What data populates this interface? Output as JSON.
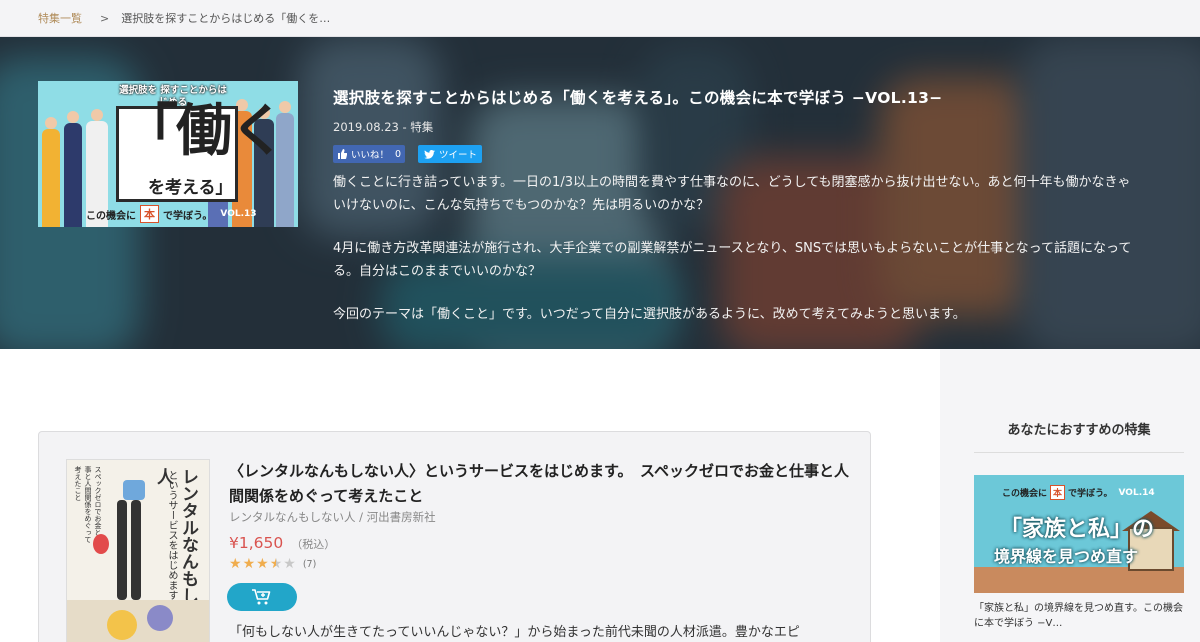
{
  "breadcrumb": {
    "root": "特集一覧",
    "separator": ">",
    "current": "選択肢を探すことからはじめる「働くを…"
  },
  "feature": {
    "title": "選択肢を探すことからはじめる「働くを考える」。この機会に本で学ぼう −VOL.13−",
    "meta": "2019.08.23 - 特集",
    "like_label": "いいね！",
    "like_count": "0",
    "tweet_label": "ツイート",
    "description": [
      "働くことに行き詰っています。一日の1/3以上の時間を費やす仕事なのに、どうしても閉塞感から抜け出せない。あと何十年も働かなきゃいけないのに、こんな気持ちでもつのかな？先は明るいのかな？",
      "4月に働き方改革関連法が施行され、大手企業での副業解禁がニュースとなり、SNSでは思いもよらないことが仕事となって話題になってる。自分はこのままでいいのかな？",
      "今回のテーマは「働くこと」です。いつだって自分に選択肢があるように、改めて考えてみようと思います。"
    ],
    "image": {
      "top_text": "選択肢を 探すことからはじめる",
      "big_text": "「働く",
      "sub_text": "を考える」",
      "bottom_prefix": "この機会に",
      "bottom_book": "本",
      "bottom_suffix": "で学ぼう。",
      "vol": "VOL.13"
    }
  },
  "sidebar": {
    "heading": "あなたにおすすめの特集",
    "card": {
      "image": {
        "prefix": "この機会に",
        "book": "本",
        "suffix": "で学ぼう。",
        "vol": "VOL.14",
        "line1": "「家族と私」の",
        "line2": "境界線を見つめ直す"
      },
      "caption": "「家族と私」の境界線を見つめ直す。この機会に本で学ぼう −V…"
    }
  },
  "book": {
    "title": "〈レンタルなんもしない人〉というサービスをはじめます。　スペックゼロでお金と仕事と人間関係をめぐって考えたこと",
    "author_publisher": "レンタルなんもしない人 / 河出書房新社",
    "price": "¥1,650",
    "tax_note": "（税込）",
    "rating": 3.5,
    "rating_count": "(7)",
    "description": "「何もしない人が生きてたっていいんじゃない？」から始まった前代未聞の人材派遣。豊かなエピ",
    "cover": {
      "title_vertical": "レンタルなんもしない人",
      "subtitle_vertical": "というサービスをはじめます。",
      "tagline": "スペックゼロでお金と仕事と人間関係をめぐって考えたこと"
    }
  },
  "colors": {
    "breadcrumb_link": "#b08c5a",
    "price": "#d9534f",
    "star": "#f0ad4e",
    "cart": "#22a6c9",
    "facebook": "#4267b2",
    "twitter": "#1da1f2"
  },
  "icons": {
    "like": "thumbs-up-icon",
    "tweet": "twitter-bird-icon",
    "cart": "cart-add-icon"
  }
}
